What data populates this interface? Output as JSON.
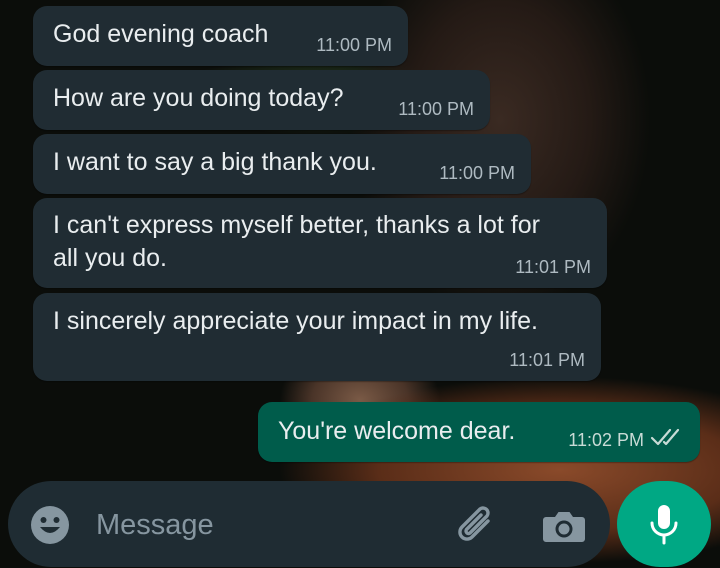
{
  "messages": [
    {
      "direction": "incoming",
      "text": "God evening coach",
      "time": "11:00 PM"
    },
    {
      "direction": "incoming",
      "text": "How are you doing today?",
      "time": "11:00 PM"
    },
    {
      "direction": "incoming",
      "text": "I want to say a big thank you.",
      "time": "11:00 PM"
    },
    {
      "direction": "incoming",
      "text": "I can't express myself better, thanks a lot for\nall you do.",
      "time": "11:01 PM"
    },
    {
      "direction": "incoming",
      "text": "I sincerely appreciate your impact in my life.",
      "time": "11:01 PM"
    },
    {
      "direction": "outgoing",
      "text": "You're welcome dear.",
      "time": "11:02 PM",
      "status": "delivered-double-check"
    }
  ],
  "composer": {
    "placeholder": "Message",
    "icons": [
      "emoji-icon",
      "attach-icon",
      "camera-icon",
      "mic-icon"
    ]
  },
  "colors": {
    "incoming_bubble": "#202c33",
    "outgoing_bubble": "#005c4b",
    "mic_button": "#00a884",
    "input_bar": "#1f2c33"
  }
}
